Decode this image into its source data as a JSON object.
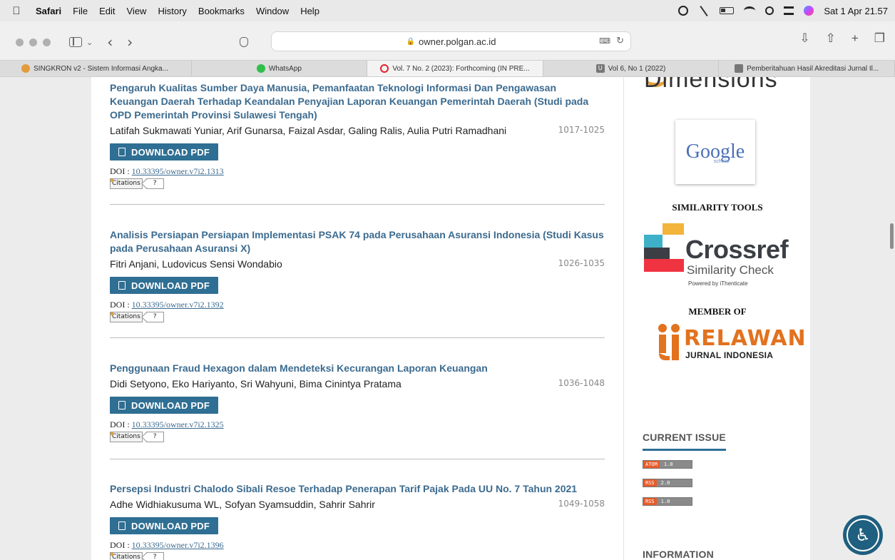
{
  "menubar": {
    "app": "Safari",
    "items": [
      "File",
      "Edit",
      "View",
      "History",
      "Bookmarks",
      "Window",
      "Help"
    ],
    "datetime": "Sat 1 Apr 21.57"
  },
  "browser": {
    "url": "owner.polgan.ac.id",
    "tabs": [
      {
        "label": "SINGKRON v2 - Sistem Informasi Angka..."
      },
      {
        "label": "WhatsApp"
      },
      {
        "label": "Vol. 7 No. 2 (2023): Forthcoming (IN PRE..."
      },
      {
        "label": "Vol 6, No 1 (2022)"
      },
      {
        "label": "Pemberitahuan Hasil Akreditasi Jurnal Il..."
      }
    ]
  },
  "articles": [
    {
      "title": "Pengaruh Kualitas Sumber Daya Manusia, Pemanfaatan Teknologi Informasi Dan Pengawasan Keuangan Daerah Terhadap Keandalan Penyajian Laporan Keuangan Pemerintah Daerah (Studi pada OPD Pemerintah Provinsi Sulawesi Tengah)",
      "authors": "Latifah Sukmawati Yuniar, Arif Gunarsa, Faizal Asdar, Galing Ralis, Aulia Putri Ramadhani",
      "pages": "1017-1025",
      "download_label": "DOWNLOAD PDF",
      "doi_label": "DOI :",
      "doi": "10.33395/owner.v7i2.1313",
      "citations_label": "Citations",
      "citations_count": "?"
    },
    {
      "title": "Analisis Persiapan Persiapan Implementasi PSAK 74 pada Perusahaan Asuransi Indonesia (Studi Kasus pada Perusahaan Asuransi X)",
      "authors": "Fitri Anjani, Ludovicus Sensi Wondabio",
      "pages": "1026-1035",
      "download_label": "DOWNLOAD PDF",
      "doi_label": "DOI :",
      "doi": "10.33395/owner.v7i2.1392",
      "citations_label": "Citations",
      "citations_count": "?"
    },
    {
      "title": "Penggunaan Fraud Hexagon dalam Mendeteksi Kecurangan Laporan Keuangan",
      "authors": "Didi Setyono, Eko Hariyanto, Sri Wahyuni, Bima Cinintya Pratama",
      "pages": "1036-1048",
      "download_label": "DOWNLOAD PDF",
      "doi_label": "DOI :",
      "doi": "10.33395/owner.v7i2.1325",
      "citations_label": "Citations",
      "citations_count": "?"
    },
    {
      "title": "Persepsi Industri Chalodo Sibali Resoe Terhadap Penerapan Tarif Pajak Pada UU No. 7 Tahun 2021",
      "authors": "Adhe Widhiakusuma WL, Sofyan Syamsuddin, Sahrir Sahrir",
      "pages": "1049-1058",
      "download_label": "DOWNLOAD PDF",
      "doi_label": "DOI :",
      "doi": "10.33395/owner.v7i2.1396",
      "citations_label": "Citations",
      "citations_count": "?"
    }
  ],
  "sidebar": {
    "dimensions_text": "Dimensions",
    "google_text": "Google",
    "scholar_text": "scholar",
    "similarity_heading": "SIMILARITY TOOLS",
    "crossref_text": "Crossref",
    "crossref_sub": "Similarity Check",
    "crossref_powered": "Powered by iThenticate",
    "member_heading": "MEMBER OF",
    "relawan_text": "RELAWAN",
    "relawan_sub": "JURNAL INDONESIA",
    "current_issue_title": "CURRENT ISSUE",
    "feeds": [
      {
        "key": "ATOM",
        "version": "1.0"
      },
      {
        "key": "RSS",
        "version": "2.0"
      },
      {
        "key": "RSS",
        "version": "1.0"
      }
    ],
    "information_title": "INFORMATION"
  },
  "colors": {
    "accent": "#2f6f93",
    "title": "#3c6b8f",
    "crossref_orange": "#e8a23d",
    "relawan_orange": "#e2721e"
  }
}
